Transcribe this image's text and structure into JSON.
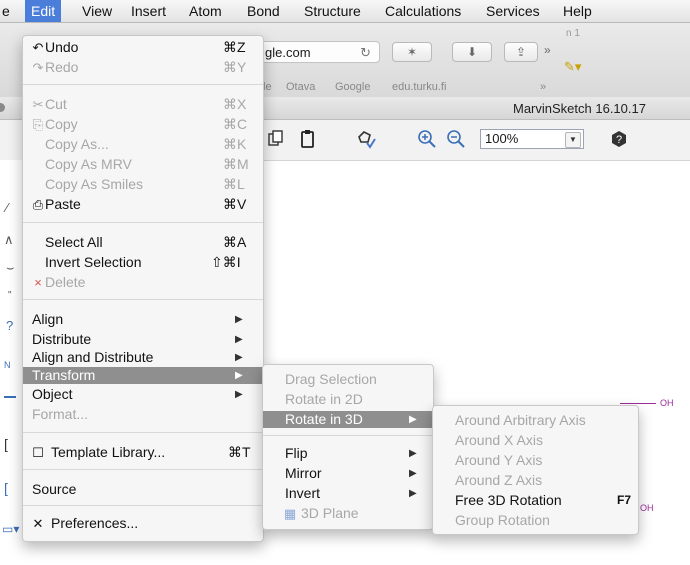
{
  "menubar": {
    "partial_left": "e",
    "items": [
      {
        "label": "Edit",
        "active": true
      },
      {
        "label": "View"
      },
      {
        "label": "Insert"
      },
      {
        "label": "Atom"
      },
      {
        "label": "Bond"
      },
      {
        "label": "Structure"
      },
      {
        "label": "Calculations"
      },
      {
        "label": "Services"
      },
      {
        "label": "Help"
      }
    ]
  },
  "browser": {
    "url_partial": "gle.com",
    "reader_symbol": "✶",
    "extra_partial": "n 1",
    "bookmarks": [
      "le",
      "Otava",
      "Google",
      "edu.turku.fi"
    ],
    "overflow": "»"
  },
  "app": {
    "title": "MarvinSketch 16.10.17",
    "zoom": "100%"
  },
  "edit_menu": {
    "items": [
      {
        "label": "Undo",
        "shortcut": "⌘Z",
        "icon": "↶"
      },
      {
        "label": "Redo",
        "shortcut": "⌘Y",
        "icon": "↷",
        "disabled": true
      },
      {
        "label": "Cut",
        "shortcut": "⌘X",
        "icon": "✂",
        "disabled": true
      },
      {
        "label": "Copy",
        "shortcut": "⌘C",
        "icon": "⎘",
        "disabled": true
      },
      {
        "label": "Copy As...",
        "shortcut": "⌘K",
        "disabled": true
      },
      {
        "label": "Copy As MRV",
        "shortcut": "⌘M",
        "disabled": true
      },
      {
        "label": "Copy As Smiles",
        "shortcut": "⌘L",
        "disabled": true
      },
      {
        "label": "Paste",
        "shortcut": "⌘V",
        "icon": "📋"
      },
      {
        "label": "Select All",
        "shortcut": "⌘A"
      },
      {
        "label": "Invert Selection",
        "shortcut": "⇧⌘I"
      },
      {
        "label": "Delete",
        "icon": "×",
        "disabled": true
      },
      {
        "label": "Align"
      },
      {
        "label": "Distribute"
      },
      {
        "label": "Align and Distribute"
      },
      {
        "label": "Transform"
      },
      {
        "label": "Object"
      },
      {
        "label": "Format...",
        "disabled": true
      },
      {
        "label": "Template Library...",
        "shortcut": "⌘T",
        "icon": "☐"
      },
      {
        "label": "Source"
      },
      {
        "label": "Preferences...",
        "icon": "✕"
      }
    ]
  },
  "transform_menu": {
    "items": [
      {
        "label": "Drag Selection",
        "disabled": true
      },
      {
        "label": "Rotate in 2D",
        "disabled": true
      },
      {
        "label": "Rotate in 3D"
      },
      {
        "label": "Flip"
      },
      {
        "label": "Mirror"
      },
      {
        "label": "Invert"
      },
      {
        "label": "3D Plane",
        "disabled": true,
        "icon": "▦"
      }
    ]
  },
  "rotate3d_menu": {
    "items": [
      {
        "label": "Around Arbitrary Axis",
        "disabled": true
      },
      {
        "label": "Around X Axis",
        "disabled": true
      },
      {
        "label": "Around Y Axis",
        "disabled": true
      },
      {
        "label": "Around Z Axis",
        "disabled": true
      },
      {
        "label": "Free 3D Rotation",
        "shortcut": "F7"
      },
      {
        "label": "Group Rotation",
        "disabled": true
      }
    ]
  },
  "canvas": {
    "atom_labels": [
      "OH",
      "OH"
    ]
  },
  "colors": {
    "menu_highlight": "#8f8f8f",
    "menubar_active": "#4b7ed8",
    "molecule": "#9b2c9b"
  }
}
